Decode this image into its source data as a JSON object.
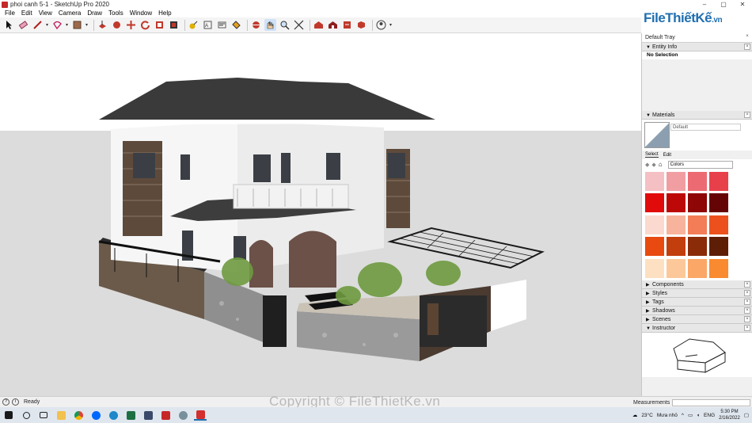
{
  "window": {
    "title": "phoi canh 5-1 - SketchUp Pro 2020",
    "controls": [
      "–",
      "▢",
      "✕"
    ]
  },
  "menu": [
    "File",
    "Edit",
    "View",
    "Camera",
    "Draw",
    "Tools",
    "Window",
    "Help"
  ],
  "brand": {
    "name": "FileThiếtKế",
    "suffix": ".vn"
  },
  "tray": {
    "title": "Default Tray",
    "entity_info": {
      "title": "Entity Info",
      "value": "No Selection"
    },
    "materials": {
      "title": "Materials",
      "name": "Default",
      "tabs": [
        "Select",
        "Edit"
      ],
      "library": "Colors",
      "swatches": [
        "#f4c0c4",
        "#f19ea3",
        "#ec6b73",
        "#e8404b",
        "#e10b0b",
        "#bd0808",
        "#8e0606",
        "#650404",
        "#fbd9cf",
        "#f7b39b",
        "#f27d57",
        "#ec511d",
        "#e84a0f",
        "#c23e0c",
        "#8a2c08",
        "#5e1d05",
        "#fde0c2",
        "#fcc89a",
        "#fba767",
        "#f98a30"
      ]
    },
    "panels": [
      "Components",
      "Styles",
      "Tags",
      "Shadows",
      "Scenes",
      "Instructor"
    ]
  },
  "status": {
    "text": "Ready",
    "measurements_label": "Measurements"
  },
  "taskbar": {
    "weather_temp": "23°C",
    "weather_text": "Mưa nhỏ",
    "lang": "ENG",
    "time": "5:30 PM",
    "date": "2/16/2022"
  },
  "watermark": "Copyright © FileThietKe.vn"
}
